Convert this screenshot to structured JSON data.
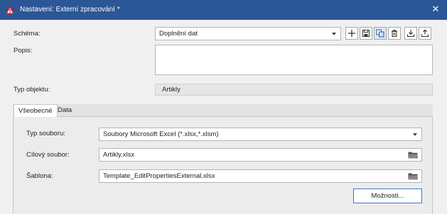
{
  "window": {
    "title": "Nastavení: Externí zpracování *",
    "app_icon": "warning-triangle-icon",
    "close_symbol": "✕",
    "accent_color": "#2b5797"
  },
  "form": {
    "schema_label": "Schéma:",
    "schema_value": "Doplnění dat",
    "description_label": "Popis:",
    "description_value": "",
    "object_type_label": "Typ objektu:",
    "object_type_value": "Artikly"
  },
  "toolbar": {
    "buttons": [
      {
        "name": "add-icon"
      },
      {
        "name": "save-icon"
      },
      {
        "name": "copy-icon"
      },
      {
        "name": "delete-icon"
      },
      {
        "name": "import-icon"
      },
      {
        "name": "export-icon"
      }
    ]
  },
  "tabs": [
    {
      "label": "Všeobecné",
      "active": true
    },
    {
      "label": "Data",
      "active": false
    }
  ],
  "general": {
    "file_type_label": "Typ souboru:",
    "file_type_value": "Soubory Microsoft Excel (*.xlsx,*.xlsm)",
    "target_file_label": "Cílový soubor:",
    "target_file_value": "Artikly.xlsx",
    "template_label": "Šablona:",
    "template_value": "Template_EditPropertiesExternal.xlsx",
    "options_button": "Možnosti..."
  }
}
